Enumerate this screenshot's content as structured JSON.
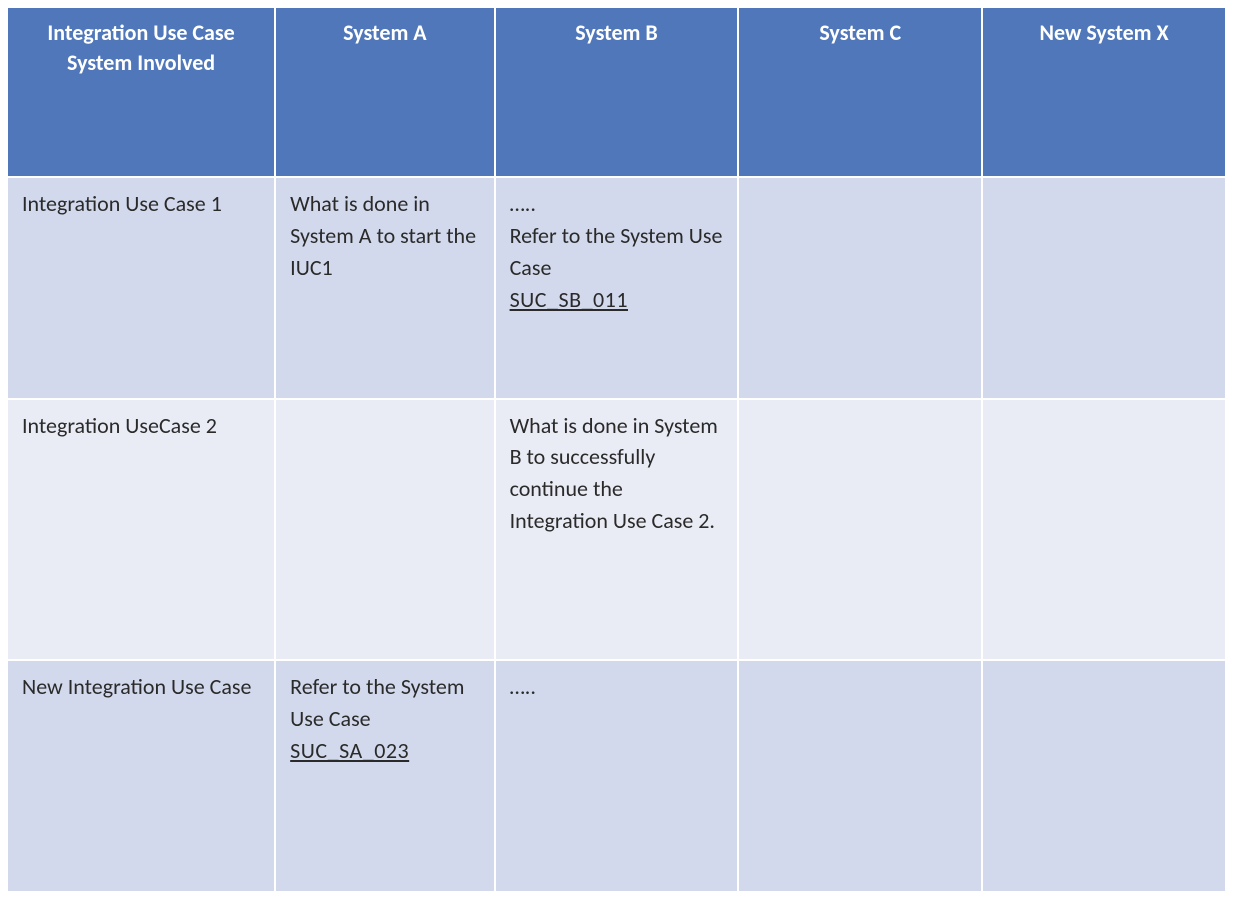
{
  "table": {
    "header": {
      "corner_line1": "Integration Use Case",
      "corner_line2": "System Involved",
      "columns": [
        "System A",
        "System B",
        "System C",
        "New System X"
      ]
    },
    "rows": [
      {
        "label": "Integration Use Case 1",
        "cells": {
          "systemA": {
            "text": "What is done in System A to start the IUC1"
          },
          "systemB": {
            "prefix": "…..",
            "text": "Refer to the System Use Case",
            "link": "SUC_SB_011"
          },
          "systemC": {
            "text": ""
          },
          "newSystemX": {
            "text": ""
          }
        }
      },
      {
        "label": "Integration UseCase 2",
        "cells": {
          "systemA": {
            "text": ""
          },
          "systemB": {
            "text": "What is done in System B to successfully continue the Integration Use Case 2."
          },
          "systemC": {
            "text": ""
          },
          "newSystemX": {
            "text": ""
          }
        }
      },
      {
        "label": "New Integration Use Case",
        "cells": {
          "systemA": {
            "text": "Refer to the System Use Case",
            "link": "SUC_SA_023"
          },
          "systemB": {
            "prefix": "….."
          },
          "systemC": {
            "text": ""
          },
          "newSystemX": {
            "text": ""
          }
        }
      }
    ]
  }
}
